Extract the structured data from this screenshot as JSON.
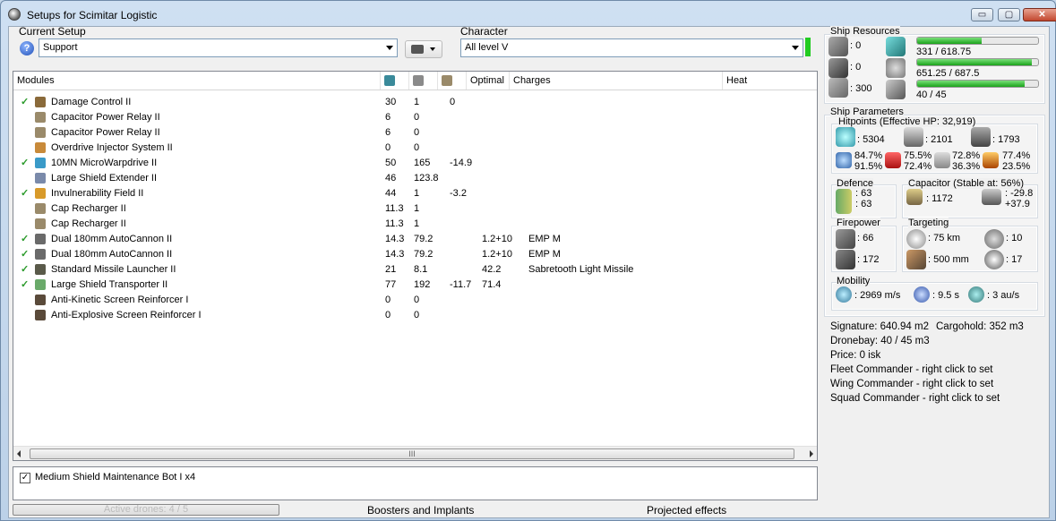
{
  "window": {
    "title": "Setups for Scimitar Logistic",
    "buttons": {
      "minimize": "▭",
      "maximize": "▢",
      "close": "✕"
    }
  },
  "setup": {
    "label": "Current Setup",
    "value": "Support"
  },
  "character": {
    "label": "Character",
    "value": "All level V"
  },
  "modules": {
    "columns": [
      "Modules",
      "Optimal",
      "Charges",
      "Heat"
    ],
    "rows": [
      {
        "check": "✓",
        "name": "Damage Control II",
        "cpu": "30",
        "pg": "1",
        "cap": "0",
        "optimal": "",
        "charges": "",
        "icon_color": "#8a6a3a"
      },
      {
        "check": "",
        "name": "Capacitor Power Relay II",
        "cpu": "6",
        "pg": "0",
        "cap": "",
        "optimal": "",
        "charges": "",
        "icon_color": "#9a8a6a"
      },
      {
        "check": "",
        "name": "Capacitor Power Relay II",
        "cpu": "6",
        "pg": "0",
        "cap": "",
        "optimal": "",
        "charges": "",
        "icon_color": "#9a8a6a"
      },
      {
        "check": "",
        "name": "Overdrive Injector System II",
        "cpu": "0",
        "pg": "0",
        "cap": "",
        "optimal": "",
        "charges": "",
        "icon_color": "#c88a3a"
      },
      {
        "check": "✓",
        "name": "10MN MicroWarpdrive II",
        "cpu": "50",
        "pg": "165",
        "cap": "-14.9",
        "optimal": "",
        "charges": "",
        "icon_color": "#3a9ac8"
      },
      {
        "check": "",
        "name": "Large Shield Extender II",
        "cpu": "46",
        "pg": "123.8",
        "cap": "",
        "optimal": "",
        "charges": "",
        "icon_color": "#7a8aaa"
      },
      {
        "check": "✓",
        "name": "Invulnerability Field II",
        "cpu": "44",
        "pg": "1",
        "cap": "-3.2",
        "optimal": "",
        "charges": "",
        "icon_color": "#d89a2a"
      },
      {
        "check": "",
        "name": "Cap Recharger II",
        "cpu": "11.3",
        "pg": "1",
        "cap": "",
        "optimal": "",
        "charges": "",
        "icon_color": "#9a8a6a"
      },
      {
        "check": "",
        "name": "Cap Recharger II",
        "cpu": "11.3",
        "pg": "1",
        "cap": "",
        "optimal": "",
        "charges": "",
        "icon_color": "#9a8a6a"
      },
      {
        "check": "✓",
        "name": "Dual 180mm AutoCannon II",
        "cpu": "14.3",
        "pg": "79.2",
        "cap": "",
        "optimal": "1.2+10",
        "charges": "EMP M",
        "icon_color": "#6a6a6a"
      },
      {
        "check": "✓",
        "name": "Dual 180mm AutoCannon II",
        "cpu": "14.3",
        "pg": "79.2",
        "cap": "",
        "optimal": "1.2+10",
        "charges": "EMP M",
        "icon_color": "#6a6a6a"
      },
      {
        "check": "✓",
        "name": "Standard Missile Launcher II",
        "cpu": "21",
        "pg": "8.1",
        "cap": "",
        "optimal": "42.2",
        "charges": "Sabretooth Light Missile",
        "icon_color": "#5a5a4a"
      },
      {
        "check": "✓",
        "name": "Large Shield Transporter II",
        "cpu": "77",
        "pg": "192",
        "cap": "-11.7",
        "optimal": "71.4",
        "charges": "",
        "icon_color": "#6aaa6a"
      },
      {
        "check": "",
        "name": "Anti-Kinetic Screen Reinforcer I",
        "cpu": "0",
        "pg": "0",
        "cap": "",
        "optimal": "",
        "charges": "",
        "icon_color": "#5a4a3a"
      },
      {
        "check": "",
        "name": "Anti-Explosive Screen Reinforcer I",
        "cpu": "0",
        "pg": "0",
        "cap": "",
        "optimal": "",
        "charges": "",
        "icon_color": "#5a4a3a"
      }
    ]
  },
  "scrollbar": {
    "grip": "III"
  },
  "drones": {
    "item": "Medium Shield Maintenance Bot I x4",
    "checked": "✓"
  },
  "bottom": {
    "active_drones": "Active drones: 4 / 5",
    "boosters": "Boosters and Implants",
    "projected": "Projected effects"
  },
  "resources": {
    "label": "Ship Resources",
    "turret": ": 0",
    "launcher": ": 0",
    "calibration": ": 300",
    "cpu": "331 / 618.75",
    "cpu_fill": 0.535,
    "powergrid": "651.25 / 687.5",
    "powergrid_fill": 0.947,
    "dronebay": "40 / 45",
    "dronebay_fill": 0.889
  },
  "params": {
    "label": "Ship Parameters",
    "hitpoints_label": "Hitpoints (Effective HP: 32,919)",
    "shield_hp": ": 5304",
    "armor_hp": ": 2101",
    "hull_hp": ": 1793",
    "res1": [
      "84.7%",
      "91.5%"
    ],
    "res2": [
      "75.5%",
      "72.4%"
    ],
    "res3": [
      "72.8%",
      "36.3%"
    ],
    "res4": [
      "77.4%",
      "23.5%"
    ],
    "defence_label": "Defence",
    "defence1": ": 63",
    "defence2": ": 63",
    "cap_label": "Capacitor (Stable at: 56%)",
    "cap_value": ": 1172",
    "cap_delta1": ": -29.8",
    "cap_delta2": "+37.9",
    "firepower_label": "Firepower",
    "fire1": ": 66",
    "fire2": ": 172",
    "targeting_label": "Targeting",
    "range": ": 75 km",
    "targets": ": 10",
    "scanres": ": 500 mm",
    "sensor": ": 17",
    "mobility_label": "Mobility",
    "speed": ": 2969 m/s",
    "align": ": 9.5 s",
    "warp": ": 3 au/s"
  },
  "info": {
    "signature": "Signature: 640.94 m2",
    "cargohold": "Cargohold: 352 m3",
    "dronebay": "Dronebay: 40 / 45 m3",
    "price": "Price: 0 isk",
    "fleet": "Fleet Commander - right click to set",
    "wing": "Wing Commander - right click to set",
    "squad": "Squad Commander - right click to set"
  }
}
